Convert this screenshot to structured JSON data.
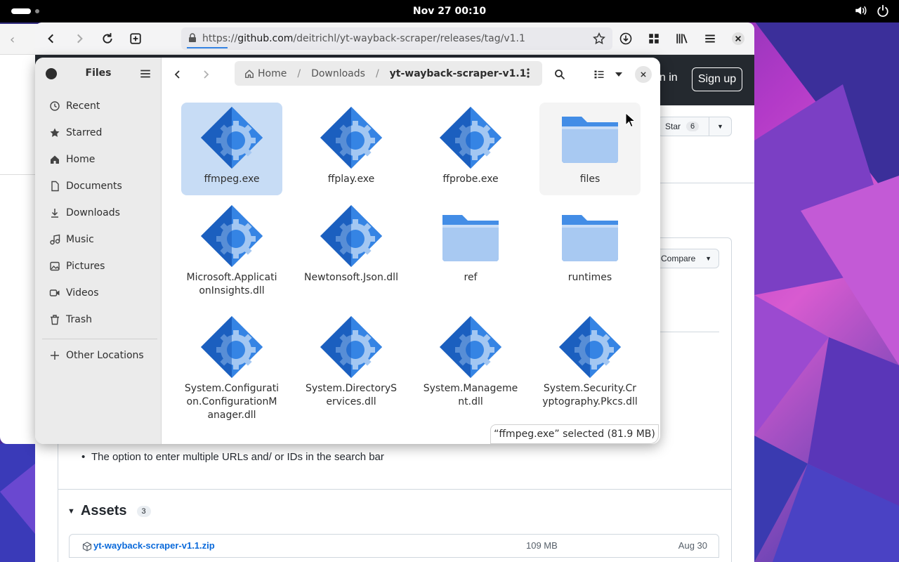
{
  "topbar": {
    "clock": "Nov 27  00:10"
  },
  "browser": {
    "url_prefix": "https://",
    "url_domain": "github.com",
    "url_path": "/deitrichl/yt-wayback-scraper/releases/tag/v1.1"
  },
  "github": {
    "sign_in": "gn in",
    "sign_up": "Sign up",
    "star_label": "Star",
    "star_count": "6",
    "compare_label": "Compare",
    "bullet_text": "The option to enter multiple URLs and/ or IDs in the search bar",
    "assets_title": "Assets",
    "assets_count": "3",
    "asset": {
      "name": "yt-wayback-scraper-v1.1.zip",
      "size": "109 MB",
      "date": "Aug 30"
    }
  },
  "files": {
    "title": "Files",
    "sidebar": [
      {
        "label": "Recent",
        "icon": "clock-icon"
      },
      {
        "label": "Starred",
        "icon": "star-icon"
      },
      {
        "label": "Home",
        "icon": "home-icon"
      },
      {
        "label": "Documents",
        "icon": "document-icon"
      },
      {
        "label": "Downloads",
        "icon": "download-icon"
      },
      {
        "label": "Music",
        "icon": "music-icon"
      },
      {
        "label": "Pictures",
        "icon": "picture-icon"
      },
      {
        "label": "Videos",
        "icon": "video-icon"
      },
      {
        "label": "Trash",
        "icon": "trash-icon"
      }
    ],
    "other_locations": "Other Locations",
    "path": {
      "home": "Home",
      "downloads": "Downloads",
      "current": "yt-wayback-scraper-v1.1"
    },
    "items": [
      {
        "name": "ffmpeg.exe",
        "type": "exec"
      },
      {
        "name": "ffplay.exe",
        "type": "exec"
      },
      {
        "name": "ffprobe.exe",
        "type": "exec"
      },
      {
        "name": "files",
        "type": "folder"
      },
      {
        "name": "Microsoft.ApplicationInsights.dll",
        "type": "exec"
      },
      {
        "name": "Newtonsoft.Json.dll",
        "type": "exec"
      },
      {
        "name": "ref",
        "type": "folder"
      },
      {
        "name": "runtimes",
        "type": "folder"
      },
      {
        "name": "System.Configuration.ConfigurationManager.dll",
        "type": "exec"
      },
      {
        "name": "System.DirectoryServices.dll",
        "type": "exec"
      },
      {
        "name": "System.Management.dll",
        "type": "exec"
      },
      {
        "name": "System.Security.Cryptography.Pkcs.dll",
        "type": "exec"
      }
    ],
    "status": "“ffmpeg.exe” selected  (81.9 MB)"
  }
}
